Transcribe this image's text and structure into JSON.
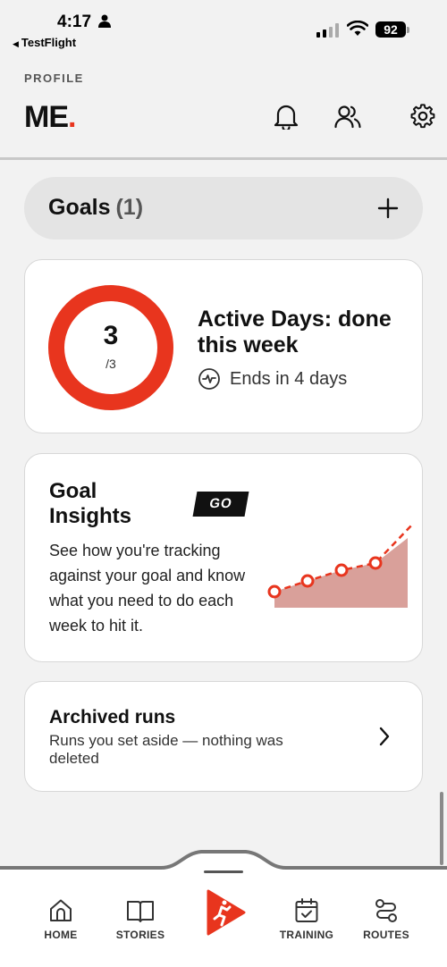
{
  "status": {
    "time": "4:17",
    "back_app": "TestFlight",
    "battery": "92"
  },
  "header": {
    "section_label": "PROFILE",
    "title": "ME",
    "title_dot": "."
  },
  "goals": {
    "title": "Goals",
    "count": "(1)"
  },
  "active_card": {
    "ring_value": "3",
    "ring_total": "/3",
    "progress": 1.0,
    "title": "Active Days: done this week",
    "ends_text": "Ends in 4 days"
  },
  "insights_card": {
    "title": "Goal Insights",
    "badge": "GO",
    "description": "See how you're tracking against your goal and know what you need to do each week to hit it."
  },
  "archived_card": {
    "title": "Archived runs",
    "description": "Runs you set aside — nothing was deleted"
  },
  "nav": {
    "home": "HOME",
    "stories": "STORIES",
    "training": "TRAINING",
    "routes": "ROUTES"
  },
  "colors": {
    "accent": "#e8351e",
    "chart_fill": "#d9a09a"
  }
}
